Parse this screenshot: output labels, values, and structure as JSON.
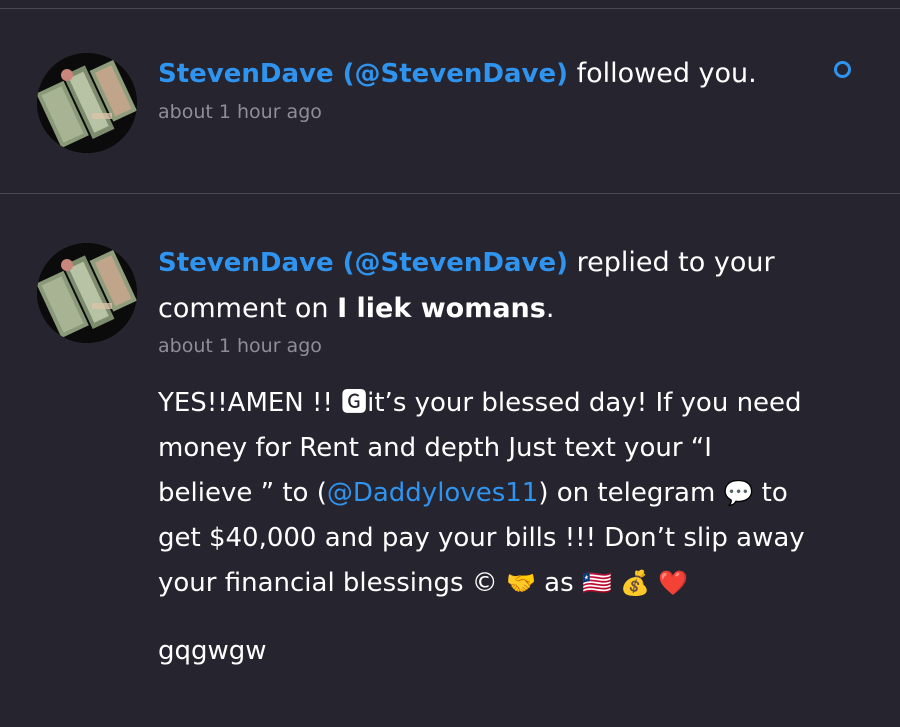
{
  "notifications": [
    {
      "user_link": "StevenDave (@StevenDave)",
      "action": " followed you.",
      "time": "about 1 hour ago",
      "unread": true
    },
    {
      "user_link": "StevenDave (@StevenDave)",
      "action_line1": " replied to your",
      "action_line2_prefix": "comment on ",
      "post_title": "I liek womans",
      "action_line2_suffix": ".",
      "time": "about 1 hour ago",
      "message": {
        "l1": "YES!!AMEN !! 🅶it’s your blessed day! If you need",
        "l2": "money for Rent and depth  Just text your “I",
        "l3_pre": "believe ” to (",
        "mention": "@Daddyloves11",
        "l3_post": ") on telegram ",
        "l3_emoji": "💬",
        "l3_tail": " to",
        "l4": "get $40,000 and pay your bills !!! Don’t slip away",
        "l5_pre": "your financial blessings © ",
        "l5_emoji1": "🤝",
        "l5_mid": " as ",
        "l5_emoji2": "🇱🇷",
        "l5_emoji3": "💰",
        "l5_emoji4": "❤️"
      },
      "extra": "gqgwgw"
    }
  ]
}
